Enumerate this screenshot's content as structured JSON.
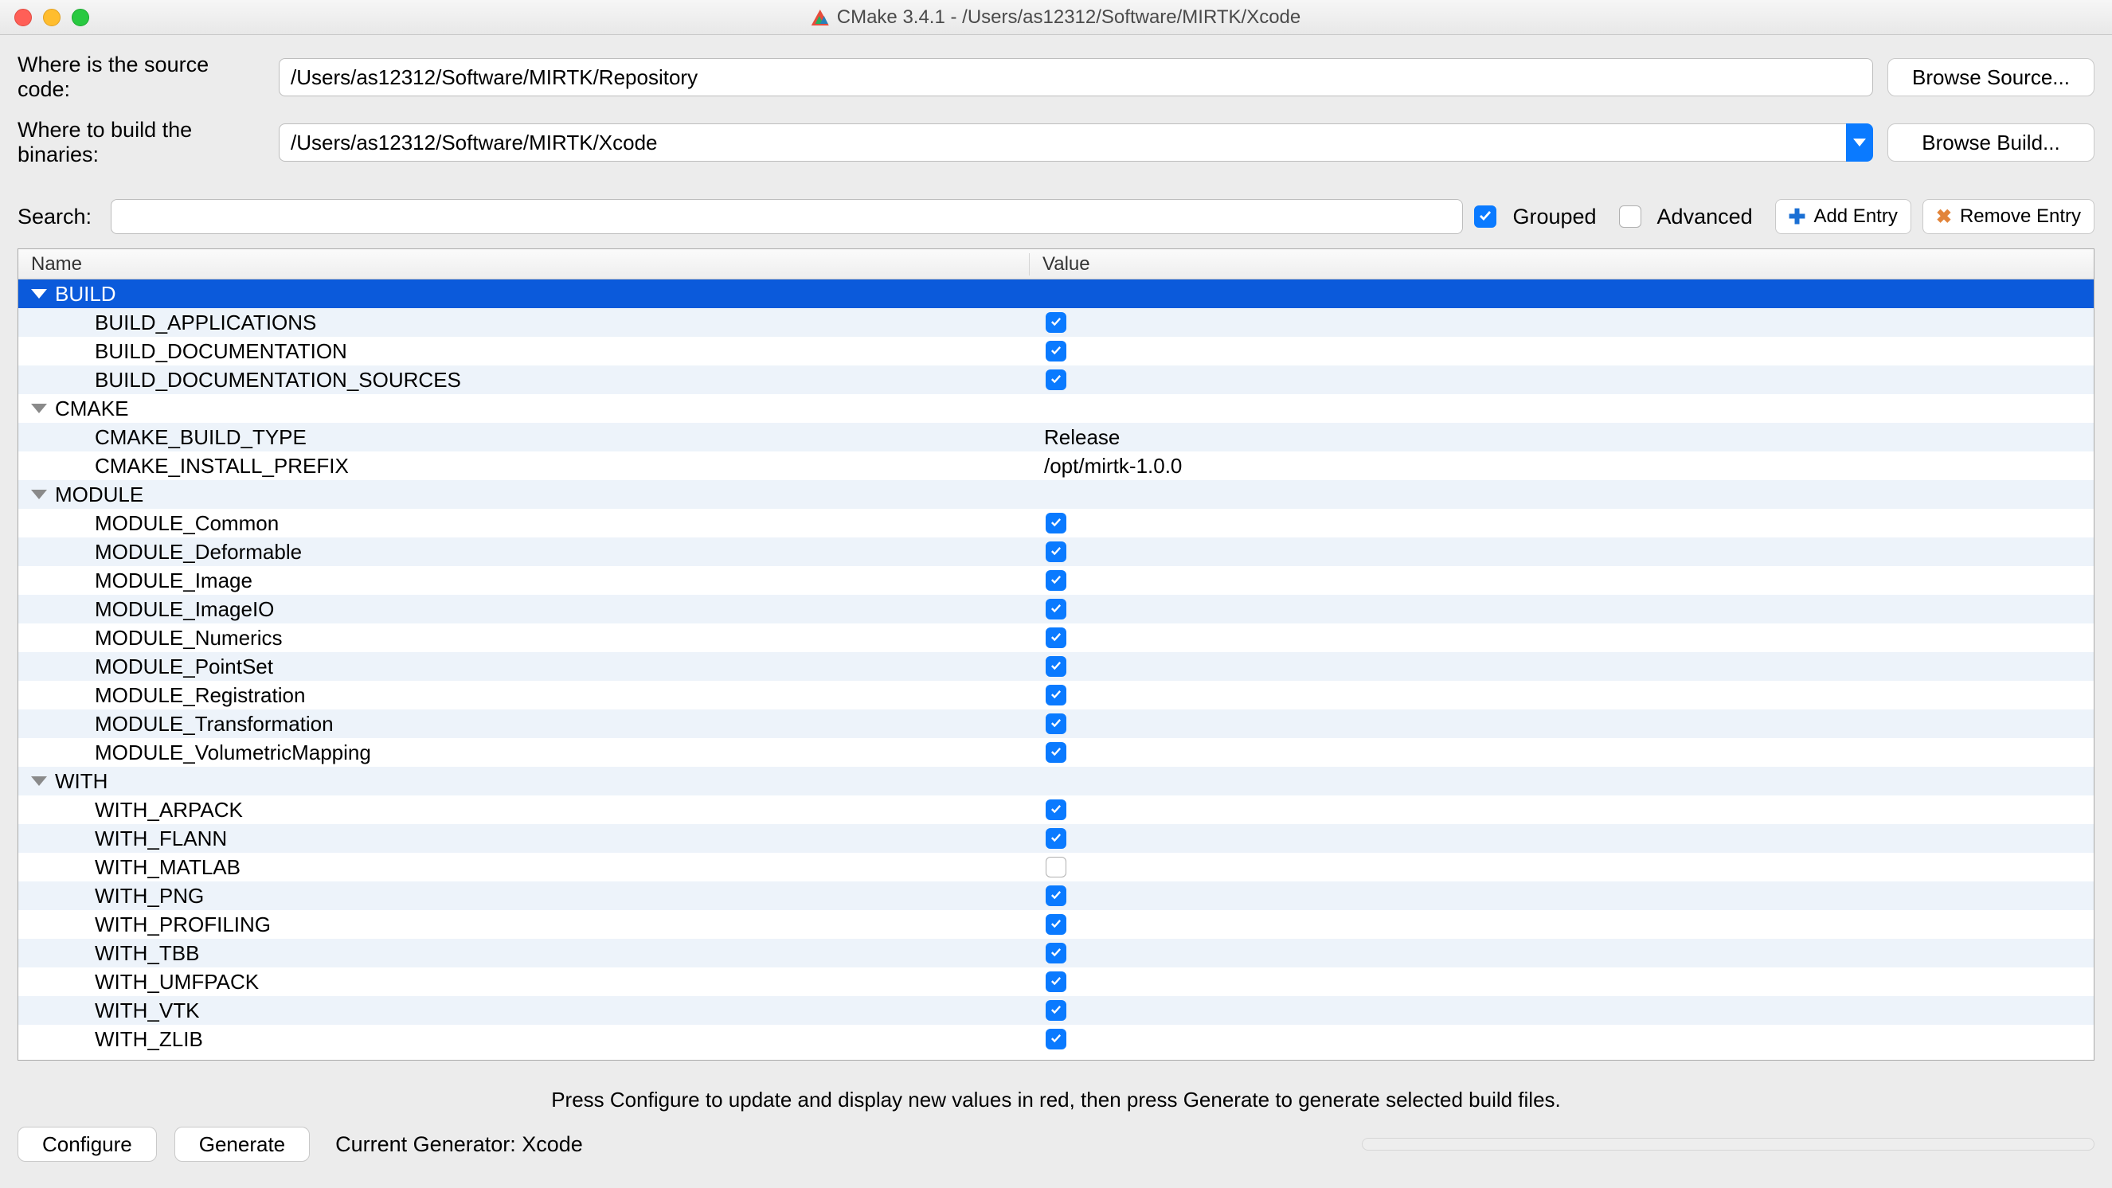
{
  "window": {
    "title": "CMake 3.4.1 - /Users/as12312/Software/MIRTK/Xcode"
  },
  "paths": {
    "source_label": "Where is the source code:",
    "source_value": "/Users/as12312/Software/MIRTK/Repository",
    "build_label": "Where to build the binaries:",
    "build_value": "/Users/as12312/Software/MIRTK/Xcode",
    "browse_source": "Browse Source...",
    "browse_build": "Browse Build..."
  },
  "toolbar": {
    "search_label": "Search:",
    "grouped_label": "Grouped",
    "grouped_checked": true,
    "advanced_label": "Advanced",
    "advanced_checked": false,
    "add_entry": "Add Entry",
    "remove_entry": "Remove Entry"
  },
  "columns": {
    "name": "Name",
    "value": "Value"
  },
  "cache": [
    {
      "group": "BUILD",
      "selected": true,
      "items": [
        {
          "name": "BUILD_APPLICATIONS",
          "type": "bool",
          "value": true
        },
        {
          "name": "BUILD_DOCUMENTATION",
          "type": "bool",
          "value": true
        },
        {
          "name": "BUILD_DOCUMENTATION_SOURCES",
          "type": "bool",
          "value": true
        }
      ]
    },
    {
      "group": "CMAKE",
      "selected": false,
      "items": [
        {
          "name": "CMAKE_BUILD_TYPE",
          "type": "string",
          "value": "Release"
        },
        {
          "name": "CMAKE_INSTALL_PREFIX",
          "type": "string",
          "value": "/opt/mirtk-1.0.0"
        }
      ]
    },
    {
      "group": "MODULE",
      "selected": false,
      "items": [
        {
          "name": "MODULE_Common",
          "type": "bool",
          "value": true
        },
        {
          "name": "MODULE_Deformable",
          "type": "bool",
          "value": true
        },
        {
          "name": "MODULE_Image",
          "type": "bool",
          "value": true
        },
        {
          "name": "MODULE_ImageIO",
          "type": "bool",
          "value": true
        },
        {
          "name": "MODULE_Numerics",
          "type": "bool",
          "value": true
        },
        {
          "name": "MODULE_PointSet",
          "type": "bool",
          "value": true
        },
        {
          "name": "MODULE_Registration",
          "type": "bool",
          "value": true
        },
        {
          "name": "MODULE_Transformation",
          "type": "bool",
          "value": true
        },
        {
          "name": "MODULE_VolumetricMapping",
          "type": "bool",
          "value": true
        }
      ]
    },
    {
      "group": "WITH",
      "selected": false,
      "items": [
        {
          "name": "WITH_ARPACK",
          "type": "bool",
          "value": true
        },
        {
          "name": "WITH_FLANN",
          "type": "bool",
          "value": true
        },
        {
          "name": "WITH_MATLAB",
          "type": "bool",
          "value": false
        },
        {
          "name": "WITH_PNG",
          "type": "bool",
          "value": true
        },
        {
          "name": "WITH_PROFILING",
          "type": "bool",
          "value": true
        },
        {
          "name": "WITH_TBB",
          "type": "bool",
          "value": true
        },
        {
          "name": "WITH_UMFPACK",
          "type": "bool",
          "value": true
        },
        {
          "name": "WITH_VTK",
          "type": "bool",
          "value": true
        },
        {
          "name": "WITH_ZLIB",
          "type": "bool",
          "value": true
        }
      ]
    }
  ],
  "hint": "Press Configure to update and display new values in red, then press Generate to generate selected build files.",
  "footer": {
    "configure": "Configure",
    "generate": "Generate",
    "generator_label": "Current Generator: Xcode"
  }
}
